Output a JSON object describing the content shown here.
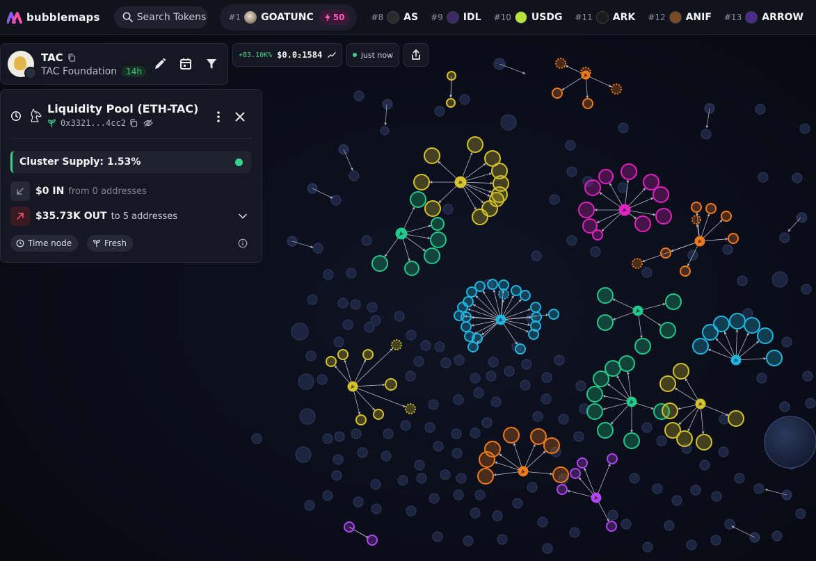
{
  "brand": {
    "name": "bubblemaps"
  },
  "search": {
    "placeholder": "Search Tokens"
  },
  "featured_token": {
    "rank": "#1",
    "name": "GOATUNC",
    "boost": "50"
  },
  "ticker": [
    {
      "rank": "#8",
      "name": "AS",
      "color": "#2a2a2a"
    },
    {
      "rank": "#9",
      "name": "IDL",
      "color": "#3b2a66"
    },
    {
      "rank": "#10",
      "name": "USDG",
      "color": "#b9e23a"
    },
    {
      "rank": "#11",
      "name": "ARK",
      "color": "#1b1b1b"
    },
    {
      "rank": "#12",
      "name": "ANIF",
      "color": "#7a4a22"
    },
    {
      "rank": "#13",
      "name": "ARROW",
      "color": "#4b2c8c"
    }
  ],
  "token": {
    "symbol": "TAC",
    "org": "TAC Foundation",
    "age": "14h"
  },
  "price": {
    "change": "+83.10K%",
    "value": "$0.0₂1584"
  },
  "status": {
    "updated": "just now"
  },
  "pool": {
    "title": "Liquidity Pool (ETH-TAC)",
    "address": "0x3321...4cc2",
    "cluster_supply": "Cluster Supply: 1.53%",
    "in_amount": "$0 IN",
    "in_desc": "from 0 addresses",
    "out_amount": "$35.73K OUT",
    "out_desc": "to 5 addresses",
    "tags": [
      "Time node",
      "Fresh"
    ]
  },
  "colors": {
    "yellow": "#d6c22b",
    "green": "#22c98a",
    "magenta": "#e022c0",
    "orange": "#f07a1e",
    "cyan": "#1fb6e0",
    "purple": "#b144f0",
    "accent_green": "#35d48c",
    "boost_pink": "#ff58b8"
  }
}
